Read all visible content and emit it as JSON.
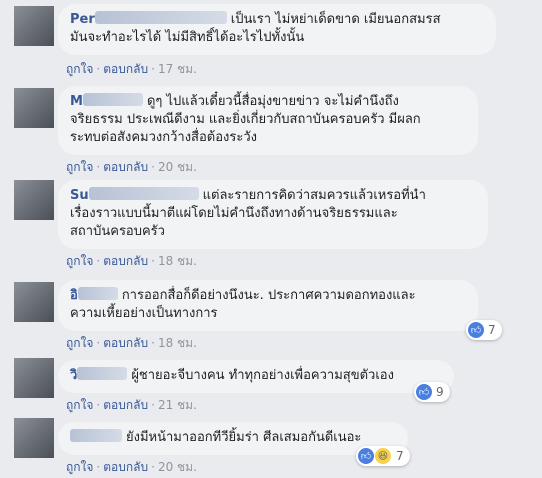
{
  "ui": {
    "like_label": "ถูกใจ",
    "reply_label": "ตอบกลับ",
    "dot": "·"
  },
  "comments": [
    {
      "name": "Per",
      "lines": [
        "เป็นเรา ไม่หย่าเด็ดขาด เมียนอกสมรส",
        "มันจะทำอะไรได้ ไม่มีสิทธิ์ได้อะไรไปทั้งนั้น"
      ],
      "time": "17 ชม."
    },
    {
      "name": "M",
      "lines": [
        "ดูๆ ไปแล้วเดี๋ยวนี้สื่อมุ่งขายข่าว จะไม่คำนึงถึง",
        "จริยธรรม ประเพณีดีงาม และยิ่งเกี่ยวกับสถาบันครอบครัว มีผลก",
        "ระทบต่อสังคมวงกว้างสื่อต้องระวัง"
      ],
      "time": "20 ชม."
    },
    {
      "name": "Su",
      "lines": [
        "แต่ละรายการคิดว่าสมควรแล้วเหรอที่นำ",
        "เรื่องราวแบบนี้มาตีแผ่โดยไม่คำนึงถึงทางด้านจริยธรรมและ",
        "สถาบันครอบครัว"
      ],
      "time": "18 ชม."
    },
    {
      "name": "อิ",
      "lines": [
        "การออกสื่อก็ดีอย่างนึงนะ. ประกาศความดอกทองและ",
        "ความเหี้ยอย่างเป็นทางการ"
      ],
      "time": "18 ชม.",
      "reactions": "7"
    },
    {
      "name": "วิ",
      "lines": [
        "ผู้ชายอะจีบางคน ทำทุกอย่างเพื่อความสุขตัวเอง"
      ],
      "time": "21 ชม.",
      "reactions": "9"
    },
    {
      "name": "",
      "lines": [
        "ยังมีหน้ามาออกทีวียิ้มร่า ศีลเสมอกันดีเนอะ"
      ],
      "time": "20 ชม.",
      "reactions": "7"
    }
  ]
}
